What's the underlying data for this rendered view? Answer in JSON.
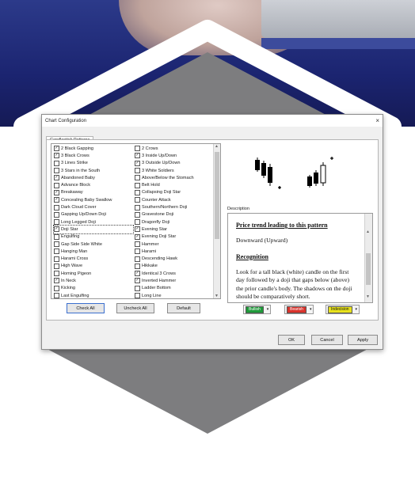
{
  "dialog": {
    "title": "Chart Configuration",
    "close_glyph": "×",
    "tab_label": "Candlestick Patterns"
  },
  "patterns_col1": [
    {
      "label": "2 Black Gapping",
      "checked": true
    },
    {
      "label": "3 Black Crows",
      "checked": true
    },
    {
      "label": "3 Lines Strike",
      "checked": false
    },
    {
      "label": "3 Stars in the South",
      "checked": false
    },
    {
      "label": "Abandoned Baby",
      "checked": true
    },
    {
      "label": "Advance Block",
      "checked": false
    },
    {
      "label": "Breakaway",
      "checked": true
    },
    {
      "label": "Concealing Baby Swallow",
      "checked": true
    },
    {
      "label": "Dark Cloud Cover",
      "checked": false
    },
    {
      "label": "Gapping Up/Down Doji",
      "checked": false
    },
    {
      "label": "Long Legged Doji",
      "checked": false
    },
    {
      "label": "Doji Star",
      "checked": true,
      "selected": true
    },
    {
      "label": "Engulfing",
      "checked": false
    },
    {
      "label": "Gap Side Side White",
      "checked": false
    },
    {
      "label": "Hanging Man",
      "checked": false
    },
    {
      "label": "Harami Cross",
      "checked": false
    },
    {
      "label": "High Wave",
      "checked": false
    },
    {
      "label": "Homing Pigeon",
      "checked": false
    },
    {
      "label": "In Neck",
      "checked": true
    },
    {
      "label": "Kicking",
      "checked": false
    },
    {
      "label": "Last Engulfing",
      "checked": false
    }
  ],
  "patterns_col2": [
    {
      "label": "2 Crows",
      "checked": false
    },
    {
      "label": "3 Inside Up/Down",
      "checked": true
    },
    {
      "label": "3 Outside Up/Down",
      "checked": true
    },
    {
      "label": "3 White Soldiers",
      "checked": false
    },
    {
      "label": "Above/Below the Stomach",
      "checked": false
    },
    {
      "label": "Belt Hold",
      "checked": false
    },
    {
      "label": "Collapsing Doji Star",
      "checked": false
    },
    {
      "label": "Counter Attack",
      "checked": false
    },
    {
      "label": "Southern/Northern Doji",
      "checked": false
    },
    {
      "label": "Gravestone Doji",
      "checked": false
    },
    {
      "label": "Dragonfly Doji",
      "checked": false
    },
    {
      "label": "Evening Star",
      "checked": true
    },
    {
      "label": "Evening Doji Star",
      "checked": true
    },
    {
      "label": "Hammer",
      "checked": false
    },
    {
      "label": "Harami",
      "checked": false
    },
    {
      "label": "Descending Hawk",
      "checked": false
    },
    {
      "label": "Hikkake",
      "checked": false
    },
    {
      "label": "Identical 3 Crows",
      "checked": true
    },
    {
      "label": "Inverted Hammer",
      "checked": true
    },
    {
      "label": "Ladder Bottom",
      "checked": false
    },
    {
      "label": "Long Line",
      "checked": false
    }
  ],
  "list_buttons": {
    "check_all": "Check All",
    "uncheck_all": "Uncheck All",
    "default": "Default"
  },
  "description": {
    "label": "Description",
    "heading1": "Price trend leading to this pattern",
    "trend": "Downward (Upward)",
    "heading2": "Recognition",
    "body": "Look for a tall black (white) candle on the first day followed by a doji that gaps below (above) the prior candle's body. The shadows on the doji should be comparatively short."
  },
  "color_buttons": {
    "bullish": {
      "label": "Bullish",
      "color": "#1f9a3a"
    },
    "bearish": {
      "label": "Bearish",
      "color": "#d9322b"
    },
    "indecision": {
      "label": "Indecision",
      "color": "#e8e21c"
    }
  },
  "footer": {
    "ok": "OK",
    "cancel": "Cancel",
    "apply": "Apply"
  },
  "check_glyph": "☑"
}
